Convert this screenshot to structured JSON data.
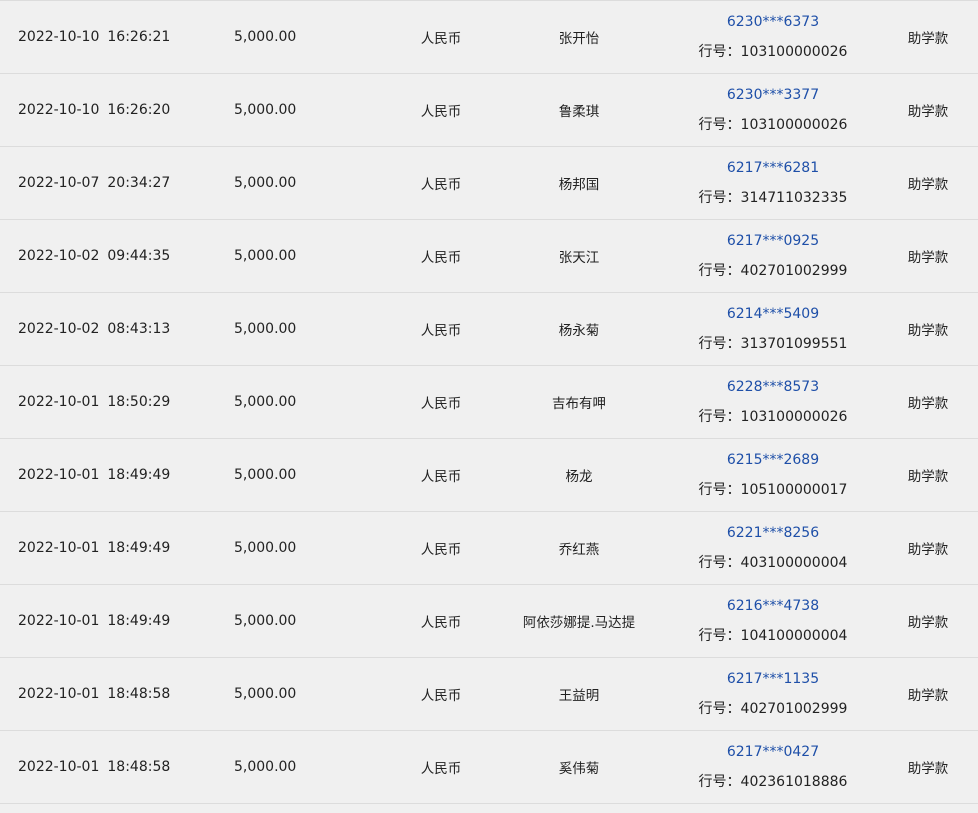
{
  "table": {
    "bank_no_prefix": "行号：",
    "rows": [
      {
        "date": "2022-10-10",
        "time": "16:26:21",
        "amount": "5,000.00",
        "currency": "人民币",
        "name": "张开怡",
        "account": "6230***6373",
        "bank_no": "103100000026",
        "purpose": "助学款"
      },
      {
        "date": "2022-10-10",
        "time": "16:26:20",
        "amount": "5,000.00",
        "currency": "人民币",
        "name": "鲁柔琪",
        "account": "6230***3377",
        "bank_no": "103100000026",
        "purpose": "助学款"
      },
      {
        "date": "2022-10-07",
        "time": "20:34:27",
        "amount": "5,000.00",
        "currency": "人民币",
        "name": "杨邦国",
        "account": "6217***6281",
        "bank_no": "314711032335",
        "purpose": "助学款"
      },
      {
        "date": "2022-10-02",
        "time": "09:44:35",
        "amount": "5,000.00",
        "currency": "人民币",
        "name": "张天江",
        "account": "6217***0925",
        "bank_no": "402701002999",
        "purpose": "助学款"
      },
      {
        "date": "2022-10-02",
        "time": "08:43:13",
        "amount": "5,000.00",
        "currency": "人民币",
        "name": "杨永菊",
        "account": "6214***5409",
        "bank_no": "313701099551",
        "purpose": "助学款"
      },
      {
        "date": "2022-10-01",
        "time": "18:50:29",
        "amount": "5,000.00",
        "currency": "人民币",
        "name": "吉布有呷",
        "account": "6228***8573",
        "bank_no": "103100000026",
        "purpose": "助学款"
      },
      {
        "date": "2022-10-01",
        "time": "18:49:49",
        "amount": "5,000.00",
        "currency": "人民币",
        "name": "杨龙",
        "account": "6215***2689",
        "bank_no": "105100000017",
        "purpose": "助学款"
      },
      {
        "date": "2022-10-01",
        "time": "18:49:49",
        "amount": "5,000.00",
        "currency": "人民币",
        "name": "乔红燕",
        "account": "6221***8256",
        "bank_no": "403100000004",
        "purpose": "助学款"
      },
      {
        "date": "2022-10-01",
        "time": "18:49:49",
        "amount": "5,000.00",
        "currency": "人民币",
        "name": "阿依莎娜提.马达提",
        "account": "6216***4738",
        "bank_no": "104100000004",
        "purpose": "助学款"
      },
      {
        "date": "2022-10-01",
        "time": "18:48:58",
        "amount": "5,000.00",
        "currency": "人民币",
        "name": "王益明",
        "account": "6217***1135",
        "bank_no": "402701002999",
        "purpose": "助学款"
      },
      {
        "date": "2022-10-01",
        "time": "18:48:58",
        "amount": "5,000.00",
        "currency": "人民币",
        "name": "奚伟菊",
        "account": "6217***0427",
        "bank_no": "402361018886",
        "purpose": "助学款"
      }
    ]
  },
  "colors": {
    "background": "#f0f0f0",
    "divider": "#dcdcdc",
    "link": "#1e4fa8",
    "text": "#222222"
  }
}
